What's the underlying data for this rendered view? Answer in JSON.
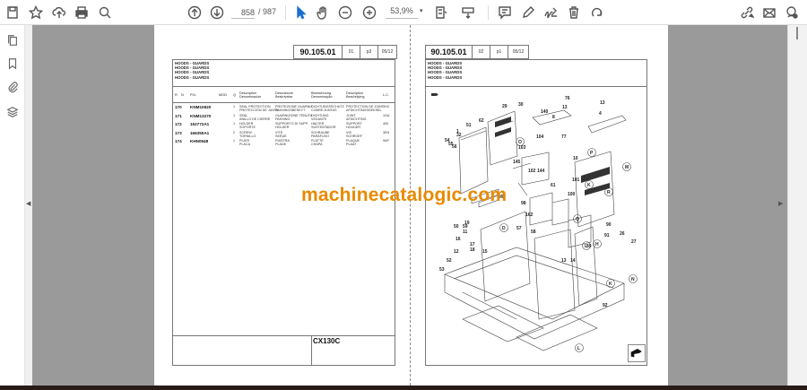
{
  "toolbar": {
    "page_current": "858",
    "page_total": "/ 987",
    "zoom": "53,9%",
    "icons": [
      "save-icon",
      "bookmark-star-icon",
      "upload-cloud-icon",
      "print-icon",
      "search-zoom-icon",
      "page-up-icon",
      "page-down-icon",
      "select-cursor-icon",
      "hand-icon",
      "zoom-out-icon",
      "zoom-in-icon",
      "fit-page-icon",
      "scroll-mode-icon",
      "comment-icon",
      "pen-icon",
      "sign-icon",
      "delete-icon",
      "rotate-icon",
      "share-link-icon",
      "mail-icon",
      "account-icon"
    ]
  },
  "sidebar": {
    "icons": [
      "pages-icon",
      "bookmarks-icon",
      "attachments-icon",
      "layers-icon"
    ]
  },
  "watermark": "machinecatalogic.com",
  "left_page": {
    "header": {
      "code": "90.105.01",
      "sub": "01",
      "page": "p3",
      "date": "05/12"
    },
    "titles": [
      "HOODS - GUARDS",
      "HOODS - GUARDS",
      "HOODS - GUARDS",
      "HOODS - GUARDS"
    ],
    "table": {
      "headers": {
        "r": "R",
        "n": "N",
        "pn": "P.N.",
        "mod": "MOD",
        "q": "Q",
        "d1": [
          "Description",
          "Denominación"
        ],
        "d2": [
          "Descrizione",
          "Beskrivelse"
        ],
        "d3": [
          "Bezeichnung",
          "Denominação"
        ],
        "d4": [
          "Description",
          "Beschrijving"
        ],
        "lc": "L.C."
      },
      "rows": [
        {
          "r": "170",
          "pn": "KNM10620",
          "q": "1",
          "d1": [
            "SEAL PROTECTION",
            "PROTECCIÓN DE JUNTA"
          ],
          "d2": [
            "PROTEZIONE GUARNIZ",
            "PAKNINGSBESKYT"
          ],
          "d3": [
            "DICHTUNGSSCHUTZ",
            "COBRE-JUNTAS"
          ],
          "d4": [
            "PROTECTION DE JOINT",
            "AFDICHTINGSDEKSEL"
          ],
          "lc": "3HC"
        },
        {
          "r": "171",
          "pn": "KNM13270",
          "q": "1",
          "d1": [
            "SEAL",
            "ANILLO DE CIERRE"
          ],
          "d2": [
            "GUARNIZIONE TENUTA",
            "PAKNING"
          ],
          "d3": [
            "DICHTUNG",
            "VEDANTE"
          ],
          "d4": [
            "JOINT",
            "AFDICHTING"
          ],
          "lc": "1GA"
        },
        {
          "r": "172",
          "pn": "152772A1",
          "q": "1",
          "d1": [
            "HOLDER",
            "SOPORTE"
          ],
          "d2": [
            "SUPPORTO DI SUPP.",
            "HOLDER"
          ],
          "d3": [
            "HALTER",
            "SUSTENTADOR"
          ],
          "d4": [
            "SUPPORT",
            "HOUDER"
          ],
          "lc": "400"
        },
        {
          "r": "173",
          "pn": "166350A1",
          "q": "2",
          "d1": [
            "SCREW",
            "TORNILLO"
          ],
          "d2": [
            "VITE",
            "SKRUE"
          ],
          "d3": [
            "SCHRAUBE",
            "PARAFUSO"
          ],
          "d4": [
            "VIS",
            "SCHROEF"
          ],
          "lc": "3KN"
        },
        {
          "r": "174",
          "pn": "KHN0548",
          "q": "1",
          "d1": [
            "PLATE",
            "PLACA"
          ],
          "d2": [
            "PIASTRA",
            "PLADE"
          ],
          "d3": [
            "PLATTE",
            "CHAPA"
          ],
          "d4": [
            "PLAQUE",
            "PLAAT"
          ],
          "lc": "9AP"
        }
      ]
    },
    "model": "CX130C"
  },
  "right_page": {
    "header": {
      "code": "90.105.01",
      "sub": "02",
      "page": "p1",
      "date": "05/12"
    },
    "titles": [
      "HOODS - GUARDS",
      "HOODS - GUARDS",
      "HOODS - GUARDS",
      "HOODS - GUARDS"
    ],
    "diagram_labels": [
      "62",
      "29",
      "30",
      "140",
      "76",
      "13",
      "13",
      "8",
      "4",
      "51",
      "1",
      "32",
      "54",
      "55",
      "56",
      "104",
      "77",
      "103",
      "145",
      "102",
      "144",
      "10",
      "61",
      "101",
      "100",
      "99",
      "98",
      "162",
      "57",
      "58",
      "59",
      "11",
      "19",
      "50",
      "16",
      "12",
      "17",
      "18",
      "15",
      "52",
      "53",
      "14",
      "13",
      "90",
      "91",
      "89",
      "92",
      "27",
      "26"
    ],
    "callouts": [
      "O",
      "P",
      "M",
      "R",
      "K",
      "Q",
      "D",
      "L",
      "N",
      "H",
      "K",
      "L"
    ]
  }
}
